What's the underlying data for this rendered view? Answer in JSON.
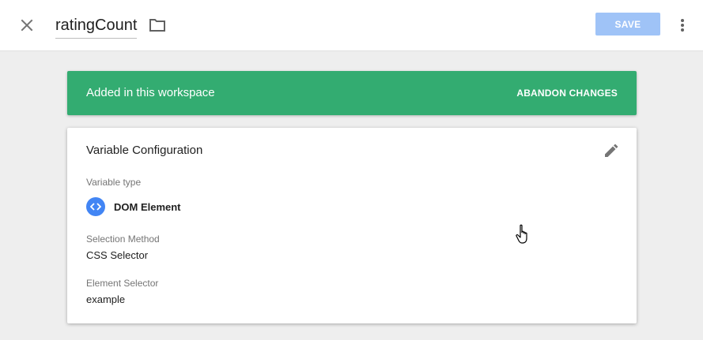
{
  "header": {
    "title": "ratingCount",
    "save_label": "SAVE",
    "close_icon": "close-icon",
    "folder_icon": "folder-icon",
    "more_icon": "more-vert-icon"
  },
  "banner": {
    "text": "Added in this workspace",
    "action_label": "ABANDON CHANGES",
    "color": "#33ac71"
  },
  "card": {
    "title": "Variable Configuration",
    "edit_icon": "pencil-icon",
    "variable_type": {
      "label": "Variable type",
      "value": "DOM Element",
      "icon": "code-brackets-icon"
    },
    "selection_method": {
      "label": "Selection Method",
      "value": "CSS Selector"
    },
    "element_selector": {
      "label": "Element Selector",
      "value": "example"
    }
  },
  "colors": {
    "accent": "#4285f4",
    "save_disabled": "#9fc3f7",
    "background": "#eeeeee"
  }
}
